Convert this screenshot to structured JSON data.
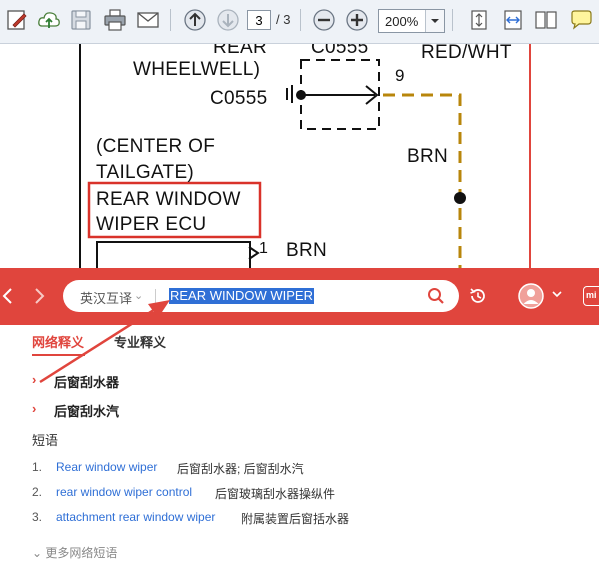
{
  "toolbar": {
    "icons": [
      "edit-icon",
      "upload-icon",
      "save-icon",
      "print-icon",
      "email-icon",
      "page-up-icon",
      "page-down-icon",
      "zoom-out-icon",
      "zoom-in-icon",
      "fit-page-icon",
      "fit-width-icon",
      "two-page-icon",
      "comment-icon"
    ],
    "page_current": "3",
    "page_total": "/ 3",
    "zoom": "200%"
  },
  "document": {
    "labels": {
      "rear": "REAR",
      "wheelwell": "WHEELWELL)",
      "c0555_top": "C0555",
      "c0555_side": "C0555",
      "red_wht": "RED/WHT",
      "pin_9": "9",
      "center_of": "(CENTER OF",
      "tailgate": "TAILGATE)",
      "brn_right": "BRN",
      "rear_window": "REAR WINDOW",
      "wiper_ecu": "WIPER ECU",
      "pin_1": "1",
      "brn_bottom": "BRN"
    }
  },
  "dictionary": {
    "lang_mode": "英汉互译",
    "query": "REAR WINDOW WIPER",
    "tabs": [
      {
        "label": "网络释义"
      },
      {
        "label": "专业释义"
      }
    ],
    "definitions": [
      {
        "text": "后窗刮水器"
      },
      {
        "text": "后窗刮水汽"
      }
    ],
    "phrase_heading": "短语",
    "phrases": [
      {
        "num": "1.",
        "en": "Rear window wiper",
        "cn": "后窗刮水器; 后窗刮水汽"
      },
      {
        "num": "2.",
        "en": "rear window wiper control",
        "cn": "后窗玻璃刮水器操纵件"
      },
      {
        "num": "3.",
        "en": "attachment rear window wiper",
        "cn": "附属装置后窗括水器"
      }
    ],
    "more_label": "更多网络短语",
    "mini_label": "mi"
  },
  "colors": {
    "accent_red": "#e0453d",
    "link_blue": "#2f6fd6",
    "wire_brown": "#b8860b",
    "highlight_box": "#d9322a"
  }
}
